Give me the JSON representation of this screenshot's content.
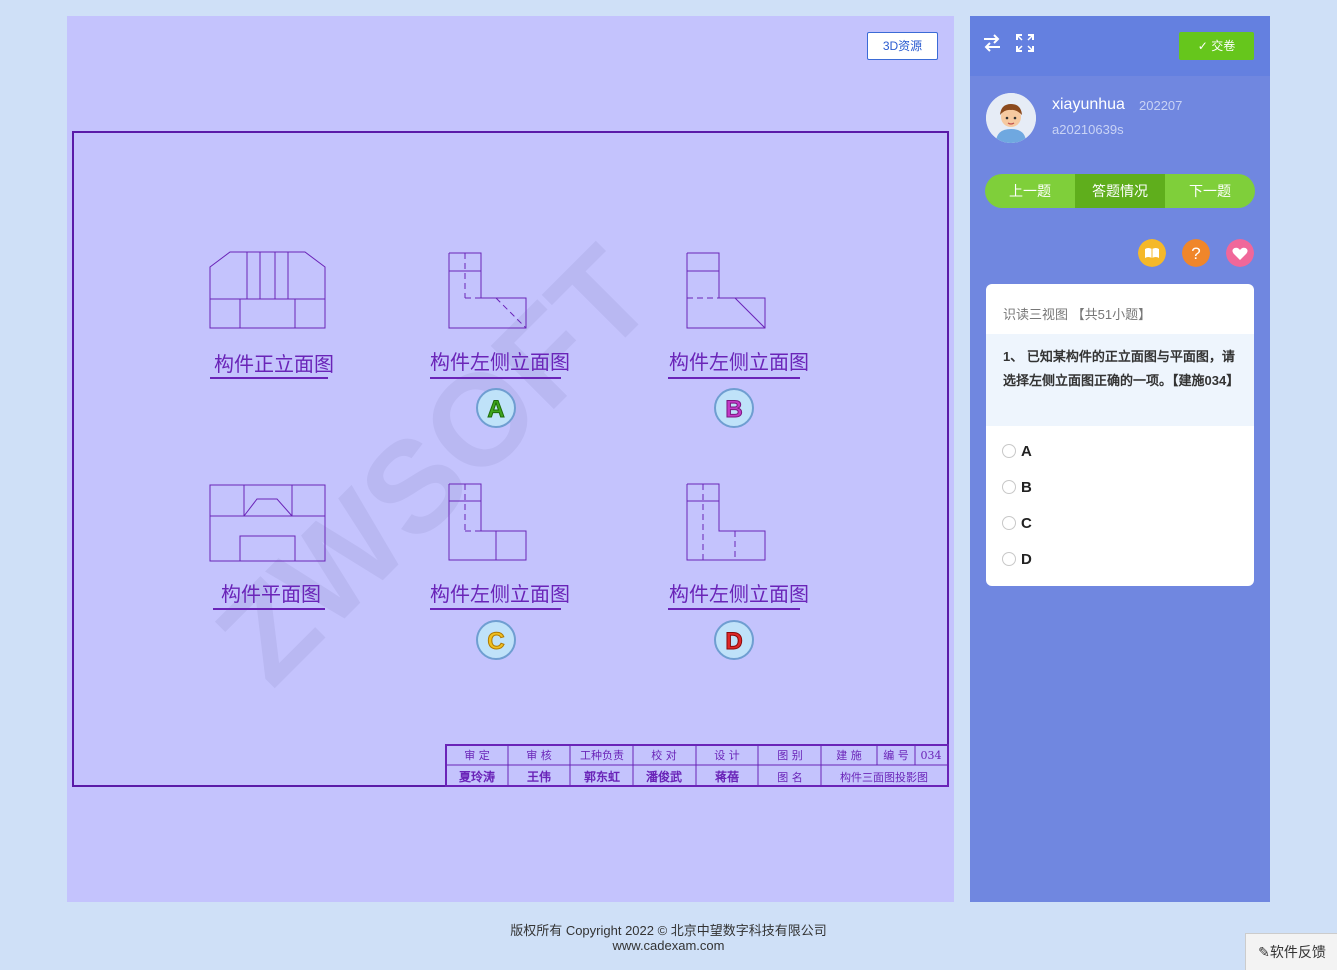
{
  "main": {
    "btn_3d": "3D资源",
    "watermark": "ZWSOFT",
    "views": [
      {
        "caption": "构件正立面图"
      },
      {
        "caption": "构件左侧立面图",
        "badge": "A"
      },
      {
        "caption": "构件左侧立面图",
        "badge": "B"
      },
      {
        "caption": "构件平面图"
      },
      {
        "caption": "构件左侧立面图",
        "badge": "C"
      },
      {
        "caption": "构件左侧立面图",
        "badge": "D"
      }
    ],
    "title_block": {
      "row1": [
        "审 定",
        "审 核",
        "工种负责",
        "校 对",
        "设 计",
        "图 别",
        "建 施",
        "编 号",
        "034"
      ],
      "row2": [
        "夏玲涛",
        "王伟",
        "郭东虹",
        "潘俊武",
        "蒋蓓",
        "图 名",
        "构件三面图投影图"
      ]
    }
  },
  "sidebar": {
    "submit_label": "交卷",
    "username": "xiayunhua",
    "user_id": "202207",
    "account": "a20210639s",
    "nav": {
      "prev": "上一题",
      "status": "答题情况",
      "next": "下一题"
    },
    "question": {
      "category": "识读三视图",
      "count": "【共51小题】",
      "text": "1、 已知某构件的正立面图与平面图，请选择左侧立面图正确的一项。【建施034】",
      "options": [
        "A",
        "B",
        "C",
        "D"
      ]
    }
  },
  "footer": {
    "copyright": "版权所有 Copyright 2022 © 北京中望数字科技有限公司",
    "website": "www.cadexam.com",
    "feedback": "软件反馈"
  },
  "colors": {
    "page_bg": "#cfe0f7",
    "main_bg": "#c4c3fd",
    "drawing_line": "#6a24b8",
    "sidebar_bg": "#7087e0",
    "accent_green": "#66c61c"
  }
}
